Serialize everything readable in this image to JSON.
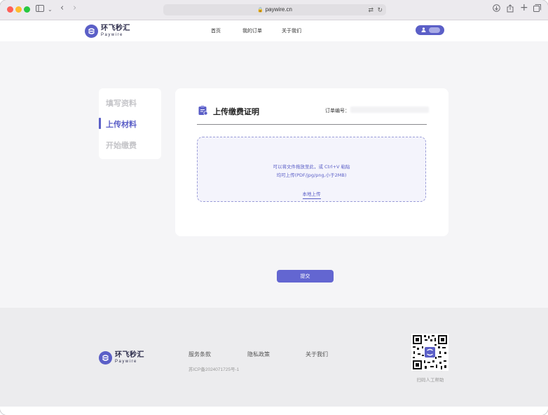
{
  "browser": {
    "url": "paywire.cn"
  },
  "brand": {
    "name_cn": "环飞秒汇",
    "name_en": "Paywire",
    "accent": "#5b5fc7"
  },
  "nav": {
    "items": [
      "首页",
      "我的订单",
      "关于我们"
    ]
  },
  "steps": {
    "items": [
      "填写资料",
      "上传材料",
      "开始缴费"
    ],
    "active_index": 1
  },
  "upload_card": {
    "title": "上传缴费证明",
    "order_label": "订单编号：",
    "dropzone_line1": "可以将文件拖放至此，或 Ctrl+V 粘贴",
    "dropzone_line2": "均可上传(PDF/jpg/png,小于2MB)",
    "local_upload": "本地上传"
  },
  "submit_label": "提交",
  "footer": {
    "links": [
      "服务条款",
      "隐私政策",
      "关于我们"
    ],
    "icp": "苏ICP备2024071725号-1",
    "qr_caption": "扫码人工帮助"
  }
}
